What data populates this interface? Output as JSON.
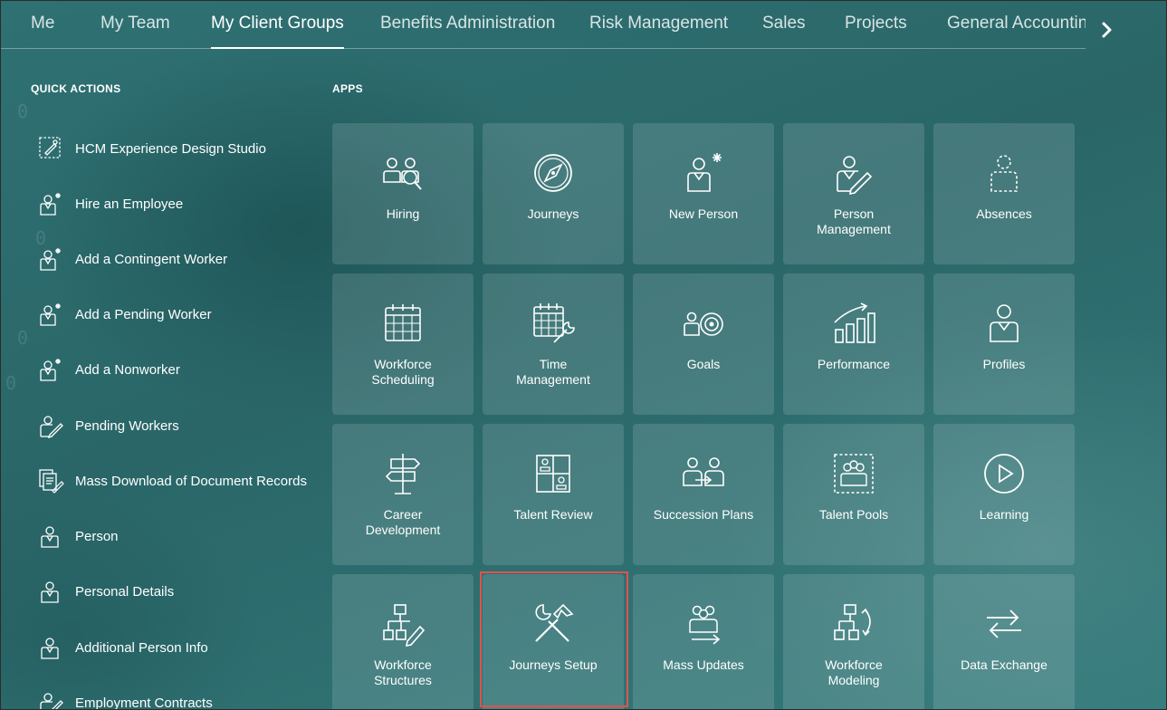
{
  "nav": {
    "tabs": [
      {
        "label": "Me"
      },
      {
        "label": "My Team"
      },
      {
        "label": "My Client Groups",
        "active": true
      },
      {
        "label": "Benefits Administration"
      },
      {
        "label": "Risk Management"
      },
      {
        "label": "Sales"
      },
      {
        "label": "Projects"
      },
      {
        "label": "General Accounting"
      }
    ],
    "next_icon": "chevron-right-icon"
  },
  "quick_actions": {
    "heading": "QUICK ACTIONS",
    "items": [
      {
        "label": "HCM Experience Design Studio",
        "icon": "design-studio-icon"
      },
      {
        "label": "Hire an Employee",
        "icon": "person-add-icon"
      },
      {
        "label": "Add a Contingent Worker",
        "icon": "person-add-icon"
      },
      {
        "label": "Add a Pending Worker",
        "icon": "person-add-icon"
      },
      {
        "label": "Add a Nonworker",
        "icon": "person-add-icon"
      },
      {
        "label": "Pending Workers",
        "icon": "person-edit-icon"
      },
      {
        "label": "Mass Download of Document Records",
        "icon": "documents-icon"
      },
      {
        "label": "Person",
        "icon": "person-icon"
      },
      {
        "label": "Personal Details",
        "icon": "person-icon"
      },
      {
        "label": "Additional Person Info",
        "icon": "person-icon"
      },
      {
        "label": "Employment Contracts",
        "icon": "person-edit-icon"
      }
    ]
  },
  "apps": {
    "heading": "APPS",
    "tiles": [
      {
        "label": "Hiring",
        "icon": "hiring-icon"
      },
      {
        "label": "Journeys",
        "icon": "compass-icon"
      },
      {
        "label": "New Person",
        "icon": "new-person-icon"
      },
      {
        "label": "Person\nManagement",
        "icon": "person-edit-icon"
      },
      {
        "label": "Absences",
        "icon": "absence-icon"
      },
      {
        "label": "Workforce\nScheduling",
        "icon": "calendar-icon"
      },
      {
        "label": "Time\nManagement",
        "icon": "calendar-wrench-icon"
      },
      {
        "label": "Goals",
        "icon": "goals-icon"
      },
      {
        "label": "Performance",
        "icon": "performance-chart-icon"
      },
      {
        "label": "Profiles",
        "icon": "profile-icon"
      },
      {
        "label": "Career\nDevelopment",
        "icon": "signpost-icon"
      },
      {
        "label": "Talent Review",
        "icon": "talent-review-icon"
      },
      {
        "label": "Succession Plans",
        "icon": "succession-icon"
      },
      {
        "label": "Talent Pools",
        "icon": "talent-pools-icon"
      },
      {
        "label": "Learning",
        "icon": "play-icon"
      },
      {
        "label": "Workforce\nStructures",
        "icon": "org-chart-icon"
      },
      {
        "label": "Journeys Setup",
        "icon": "tools-icon",
        "highlighted": true
      },
      {
        "label": "Mass Updates",
        "icon": "mass-updates-icon"
      },
      {
        "label": "Workforce\nModeling",
        "icon": "workforce-modeling-icon"
      },
      {
        "label": "Data Exchange",
        "icon": "data-exchange-icon"
      }
    ]
  },
  "colors": {
    "background": "#2d6b6e",
    "tile": "rgba(255,255,255,0.13)",
    "highlight": "#e0524f",
    "text": "#ffffff"
  }
}
